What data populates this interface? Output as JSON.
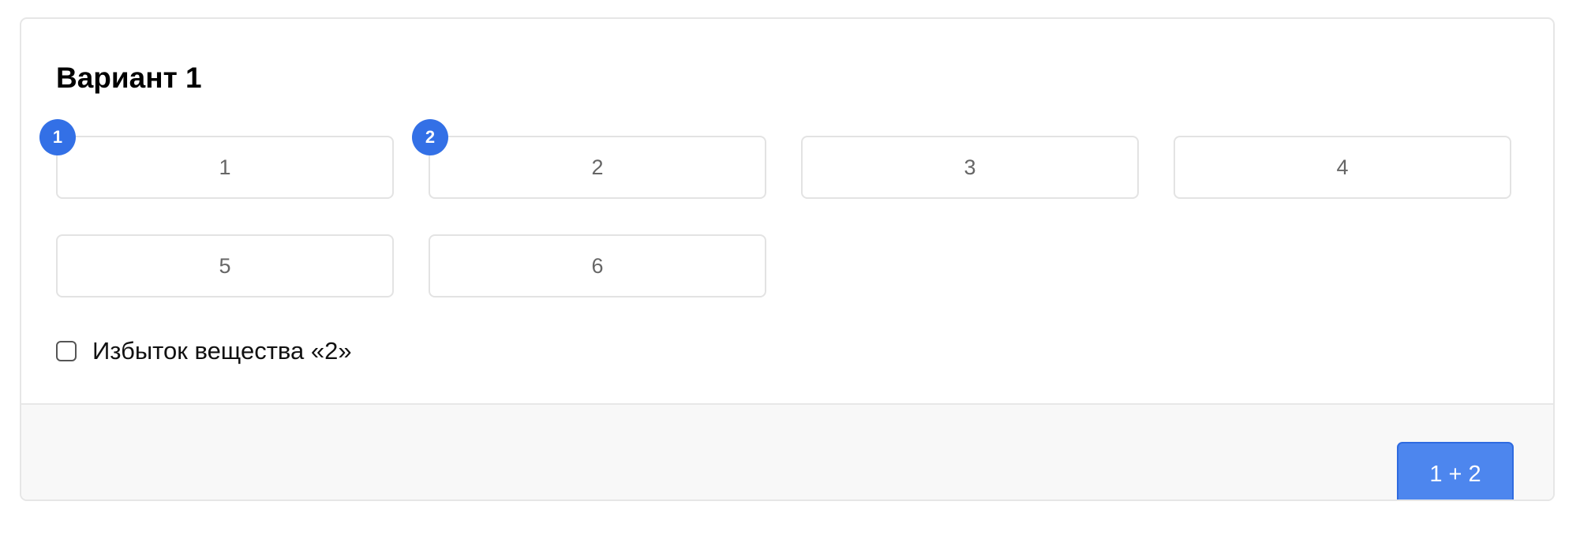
{
  "variant": {
    "title": "Вариант 1",
    "options": [
      {
        "label": "1",
        "order": "1"
      },
      {
        "label": "2",
        "order": "2"
      },
      {
        "label": "3"
      },
      {
        "label": "4"
      },
      {
        "label": "5"
      },
      {
        "label": "6"
      }
    ],
    "excess_checkbox": {
      "label": "Избыток вещества «2»",
      "checked": false
    },
    "submit_label": "1 + 2"
  },
  "colors": {
    "accent": "#3370e6",
    "button": "#4d86ee",
    "footer": "#f8f8f8",
    "border": "#e6e6e6"
  }
}
